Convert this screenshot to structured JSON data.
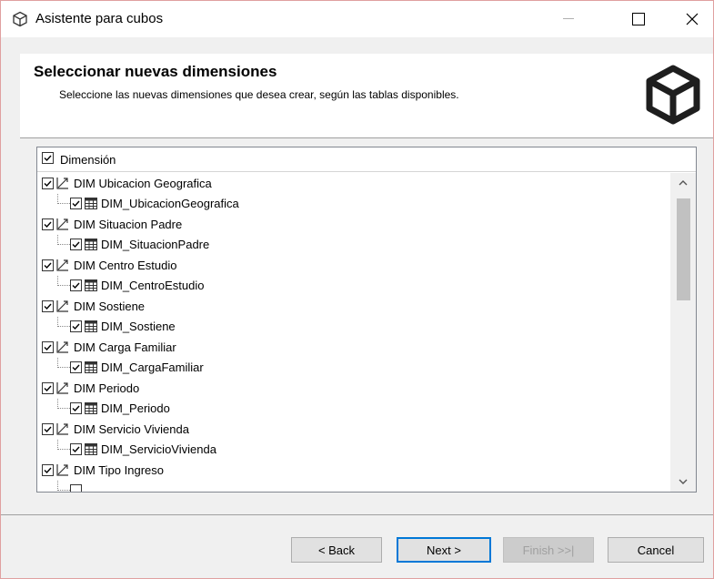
{
  "window": {
    "title": "Asistente para cubos",
    "controls": [
      "minimize",
      "maximize",
      "close"
    ]
  },
  "header": {
    "title": "Seleccionar nuevas dimensiones",
    "subtitle": "Seleccione las nuevas dimensiones que desea crear, según las tablas disponibles.",
    "icon": "cube-icon"
  },
  "tree": {
    "column_header": "Dimensión",
    "items": [
      {
        "dimension": "DIM Ubicacion Geografica",
        "table": "DIM_UbicacionGeografica",
        "checked": true
      },
      {
        "dimension": "DIM Situacion Padre",
        "table": "DIM_SituacionPadre",
        "checked": true
      },
      {
        "dimension": "DIM Centro Estudio",
        "table": "DIM_CentroEstudio",
        "checked": true
      },
      {
        "dimension": "DIM Sostiene",
        "table": "DIM_Sostiene",
        "checked": true
      },
      {
        "dimension": "DIM Carga Familiar",
        "table": "DIM_CargaFamiliar",
        "checked": true
      },
      {
        "dimension": "DIM Periodo",
        "table": "DIM_Periodo",
        "checked": true
      },
      {
        "dimension": "DIM Servicio Vivienda",
        "table": "DIM_ServicioVivienda",
        "checked": true
      },
      {
        "dimension": "DIM Tipo Ingreso",
        "table": "",
        "checked": true
      }
    ]
  },
  "buttons": {
    "back": "< Back",
    "next": "Next >",
    "finish": "Finish >>|",
    "cancel": "Cancel"
  },
  "colors": {
    "accent": "#0078d7",
    "disabled_text": "#a0a0a0"
  }
}
